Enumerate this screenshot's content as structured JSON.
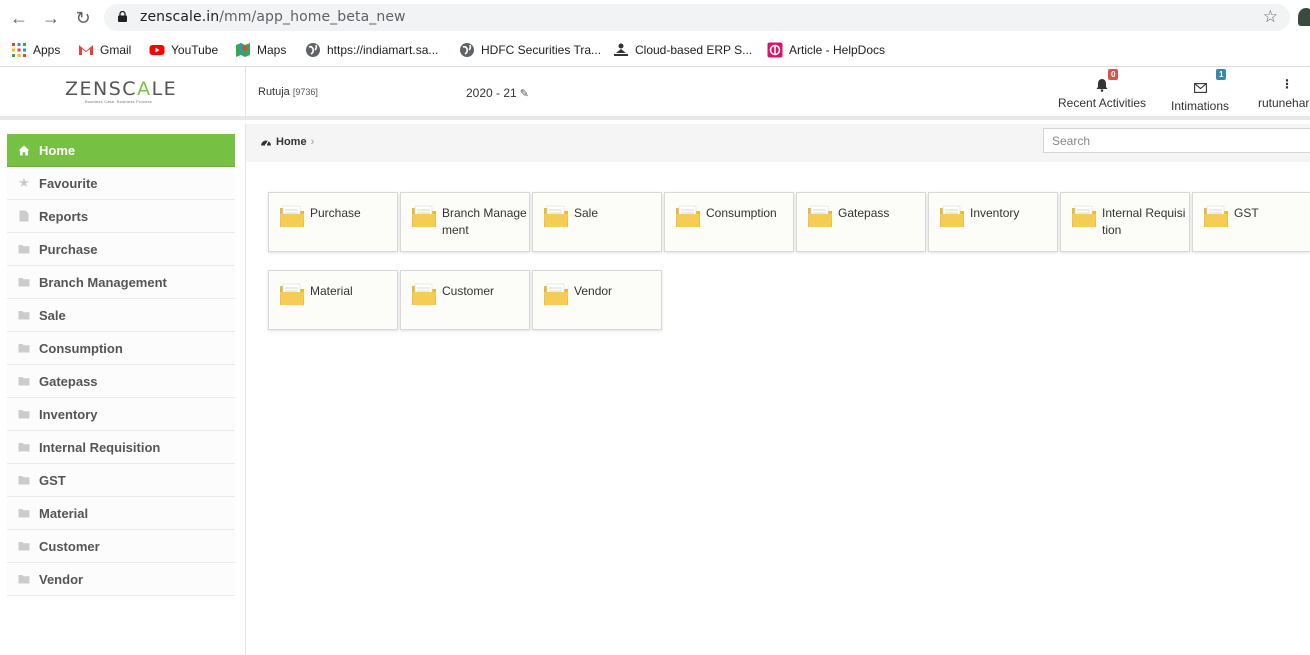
{
  "browser": {
    "url_host": "zenscale.in",
    "url_path": "/mm/app_home_beta_new",
    "bookmarks": [
      {
        "label": "Apps",
        "icon": "apps-grid-icon"
      },
      {
        "label": "Gmail",
        "icon": "gmail-icon"
      },
      {
        "label": "YouTube",
        "icon": "youtube-icon"
      },
      {
        "label": "Maps",
        "icon": "maps-icon"
      },
      {
        "label": "https://indiamart.sa...",
        "icon": "globe-icon"
      },
      {
        "label": "HDFC Securities Tra...",
        "icon": "globe-icon"
      },
      {
        "label": "Cloud-based ERP S...",
        "icon": "erp-icon"
      },
      {
        "label": "Article - HelpDocs",
        "icon": "helpdocs-icon"
      }
    ]
  },
  "header": {
    "logo_left": "ZENSC",
    "logo_mid": "A",
    "logo_right": "LE",
    "logo_tagline": "Business Case. Business Process",
    "user": "Rutuja",
    "user_id": "[9736]",
    "fiscal_year": "2020 - 21",
    "recent_label": "Recent Activities",
    "recent_count": "0",
    "intimations_label": "Intimations",
    "intimations_count": "1",
    "account_label": "rutunehare"
  },
  "sidebar": {
    "items": [
      {
        "label": "Home",
        "icon": "home-icon",
        "active": true
      },
      {
        "label": "Favourite",
        "icon": "star-icon"
      },
      {
        "label": "Reports",
        "icon": "file-icon"
      },
      {
        "label": "Purchase",
        "icon": "folder-icon"
      },
      {
        "label": "Branch Management",
        "icon": "folder-icon"
      },
      {
        "label": "Sale",
        "icon": "folder-icon"
      },
      {
        "label": "Consumption",
        "icon": "folder-icon"
      },
      {
        "label": "Gatepass",
        "icon": "folder-icon"
      },
      {
        "label": "Inventory",
        "icon": "folder-icon"
      },
      {
        "label": "Internal Requisition",
        "icon": "folder-icon"
      },
      {
        "label": "GST",
        "icon": "folder-icon"
      },
      {
        "label": "Material",
        "icon": "folder-icon"
      },
      {
        "label": "Customer",
        "icon": "folder-icon"
      },
      {
        "label": "Vendor",
        "icon": "folder-icon"
      }
    ]
  },
  "breadcrumb": {
    "home": "Home"
  },
  "search": {
    "placeholder": "Search"
  },
  "tiles": [
    {
      "label": "Purchase"
    },
    {
      "label": "Branch Management"
    },
    {
      "label": "Sale"
    },
    {
      "label": "Consumption"
    },
    {
      "label": "Gatepass"
    },
    {
      "label": "Inventory"
    },
    {
      "label": "Internal Requisition"
    },
    {
      "label": "GST"
    },
    {
      "label": "Material"
    },
    {
      "label": "Customer"
    },
    {
      "label": "Vendor"
    }
  ],
  "colors": {
    "accent": "#76c043",
    "folder": "#f2c94c",
    "badge_red": "#d9534f",
    "badge_blue": "#3a87ad"
  }
}
